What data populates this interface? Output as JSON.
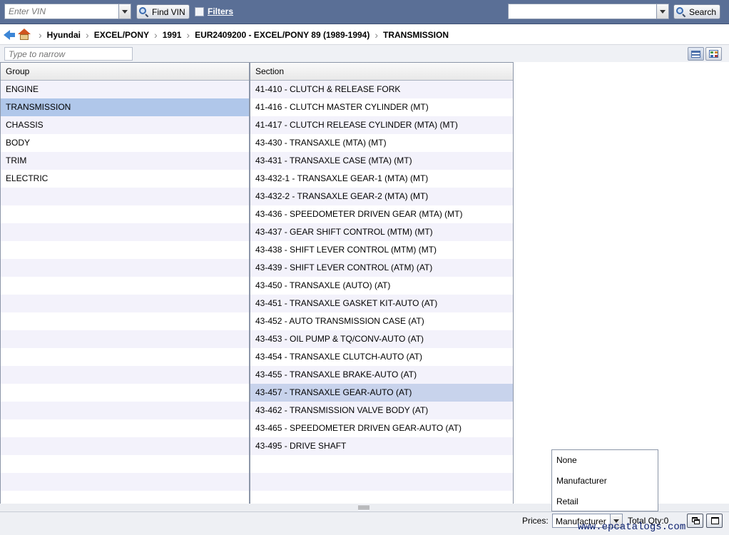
{
  "toolbar": {
    "vin_placeholder": "Enter VIN",
    "find_vin_label": "Find VIN",
    "filters_label": "Filters",
    "search_value": "",
    "search_label": "Search"
  },
  "breadcrumb": [
    "Hyundai",
    "EXCEL/PONY",
    "1991",
    "EUR2409200 - EXCEL/PONY 89 (1989-1994)",
    "TRANSMISSION"
  ],
  "narrow": {
    "placeholder": "Type to narrow"
  },
  "groups": {
    "header": "Group",
    "items": [
      "ENGINE",
      "TRANSMISSION",
      "CHASSIS",
      "BODY",
      "TRIM",
      "ELECTRIC"
    ],
    "selected": "TRANSMISSION"
  },
  "sections": {
    "header": "Section",
    "items": [
      "41-410 - CLUTCH & RELEASE FORK",
      "41-416 - CLUTCH MASTER CYLINDER (MT)",
      "41-417 - CLUTCH RELEASE CYLINDER (MTA) (MT)",
      "43-430 - TRANSAXLE (MTA) (MT)",
      "43-431 - TRANSAXLE CASE (MTA) (MT)",
      "43-432-1 - TRANSAXLE GEAR-1 (MTA) (MT)",
      "43-432-2 - TRANSAXLE GEAR-2 (MTA) (MT)",
      "43-436 - SPEEDOMETER DRIVEN GEAR (MTA) (MT)",
      "43-437 - GEAR SHIFT CONTROL (MTM) (MT)",
      "43-438 - SHIFT LEVER CONTROL (MTM) (MT)",
      "43-439 - SHIFT LEVER CONTROL (ATM) (AT)",
      "43-450 - TRANSAXLE (AUTO) (AT)",
      "43-451 - TRANSAXLE GASKET KIT-AUTO (AT)",
      "43-452 - AUTO TRANSMISSION CASE (AT)",
      "43-453 - OIL PUMP & TQ/CONV-AUTO (AT)",
      "43-454 - TRANSAXLE CLUTCH-AUTO (AT)",
      "43-455 - TRANSAXLE BRAKE-AUTO (AT)",
      "43-457 - TRANSAXLE GEAR-AUTO (AT)",
      "43-462 - TRANSMISSION VALVE BODY (AT)",
      "43-465 - SPEEDOMETER DRIVEN GEAR-AUTO (AT)",
      "43-495 - DRIVE SHAFT"
    ],
    "hovered": "43-457 - TRANSAXLE GEAR-AUTO (AT)"
  },
  "status": {
    "prices_label": "Prices:",
    "prices_value": "Manufacturer",
    "total_qty": "Total Qty:0",
    "watermark": "www.epcatalogs.com"
  },
  "prices_dropdown": [
    "None",
    "Manufacturer",
    "Retail"
  ]
}
